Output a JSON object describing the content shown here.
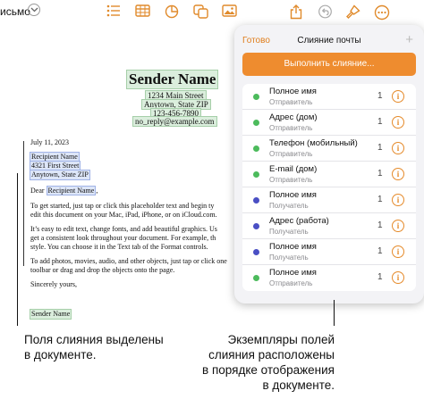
{
  "toolbar": {
    "title": "исьмо",
    "icons": [
      "chevron-down",
      "list",
      "table",
      "chart",
      "shapes",
      "media",
      "share",
      "undo",
      "brush",
      "more"
    ]
  },
  "document": {
    "sender_name": "Sender Name",
    "sender_address": [
      "1234 Main Street",
      "Anytown, State ZIP",
      "123-456-7890",
      "no_reply@example.com"
    ],
    "date": "July 11, 2023",
    "recipient": [
      "Recipient Name",
      "4321 First Street",
      "Anytown, State ZIP"
    ],
    "greeting_prefix": "Dear ",
    "greeting_field": "Recipient Name",
    "greeting_suffix": ",",
    "paragraphs": [
      "To get started, just tap or click this placeholder text and begin ty",
      "edit this document on your Mac, iPad, iPhone, or on iCloud.com.",
      "It’s easy to edit text, change fonts, and add beautiful graphics. Us",
      "get a consistent look throughout your document. For example, th",
      "style. You can choose it in the Text tab of the Format controls.",
      "To add photos, movies, audio, and other objects, just tap or click one",
      "toolbar or drag and drop the objects onto the page."
    ],
    "closing": "Sincerely yours,",
    "signature": "Sender Name"
  },
  "mail_merge": {
    "done_label": "Готово",
    "title": "Слияние почты",
    "plus_label": "+",
    "merge_button": "Выполнить слияние...",
    "rows": [
      {
        "name": "Полное имя",
        "source": "Отправитель",
        "count": "1",
        "color": "#4cbb5c"
      },
      {
        "name": "Адрес (дом)",
        "source": "Отправитель",
        "count": "1",
        "color": "#4cbb5c"
      },
      {
        "name": "Телефон (мобильный)",
        "source": "Отправитель",
        "count": "1",
        "color": "#4cbb5c"
      },
      {
        "name": "E-mail (дом)",
        "source": "Отправитель",
        "count": "1",
        "color": "#4cbb5c"
      },
      {
        "name": "Полное имя",
        "source": "Получатель",
        "count": "1",
        "color": "#4a4fc4"
      },
      {
        "name": "Адрес (работа)",
        "source": "Получатель",
        "count": "1",
        "color": "#4a4fc4"
      },
      {
        "name": "Полное имя",
        "source": "Получатель",
        "count": "1",
        "color": "#4a4fc4"
      },
      {
        "name": "Полное имя",
        "source": "Отправитель",
        "count": "1",
        "color": "#4cbb5c"
      }
    ]
  },
  "callouts": {
    "left": [
      "Поля слияния выделены",
      "в документе."
    ],
    "right": [
      "Экземпляры полей",
      "слияния расположены",
      "в порядке отображения",
      "в документе."
    ]
  },
  "colors": {
    "accent": "#ee8c2f",
    "sender_dot": "#4cbb5c",
    "recipient_dot": "#4a4fc4",
    "toolbar_icon": "#e08a2b"
  }
}
